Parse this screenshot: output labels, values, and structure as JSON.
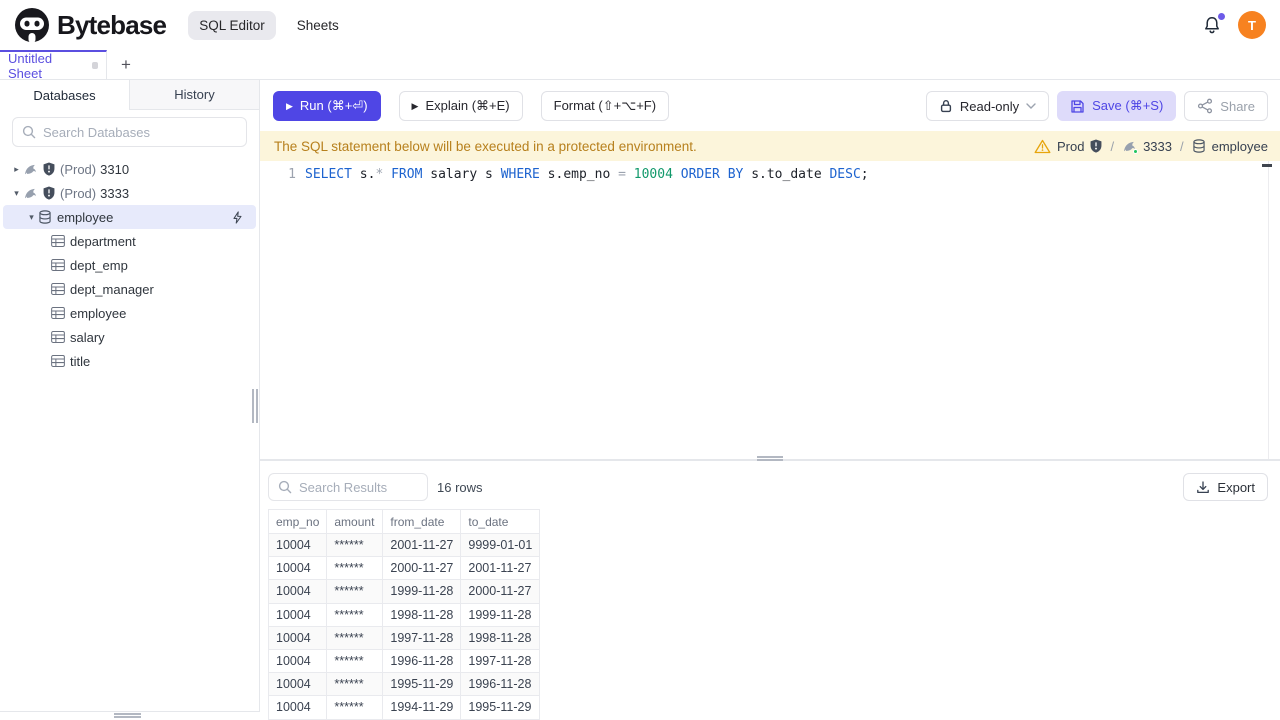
{
  "header": {
    "brand": "Bytebase",
    "nav": [
      {
        "label": "SQL Editor",
        "active": true
      },
      {
        "label": "Sheets",
        "active": false
      }
    ],
    "avatar_letter": "T"
  },
  "sheet_tabbar": {
    "active_tab_label": "Untitled Sheet",
    "new_tab_label": "+"
  },
  "sidebar": {
    "tabs": [
      {
        "label": "Databases",
        "active": true
      },
      {
        "label": "History",
        "active": false
      }
    ],
    "search_placeholder": "Search Databases",
    "tree": [
      {
        "kind": "instance",
        "twisty": "collapsed",
        "env": "(Prod)",
        "name": "3310",
        "icons": [
          "mysql",
          "shield"
        ],
        "indent": 10
      },
      {
        "kind": "instance",
        "twisty": "expanded",
        "env": "(Prod)",
        "name": "3333",
        "icons": [
          "mysql",
          "shield"
        ],
        "indent": 10
      },
      {
        "kind": "database",
        "twisty": "expanded",
        "name": "employee",
        "icons": [
          "database"
        ],
        "indent": 22,
        "selected": true,
        "bolt": true
      },
      {
        "kind": "table",
        "name": "department",
        "icons": [
          "table"
        ],
        "indent": 51
      },
      {
        "kind": "table",
        "name": "dept_emp",
        "icons": [
          "table"
        ],
        "indent": 51
      },
      {
        "kind": "table",
        "name": "dept_manager",
        "icons": [
          "table"
        ],
        "indent": 51
      },
      {
        "kind": "table",
        "name": "employee",
        "icons": [
          "table"
        ],
        "indent": 51
      },
      {
        "kind": "table",
        "name": "salary",
        "icons": [
          "table"
        ],
        "indent": 51
      },
      {
        "kind": "table",
        "name": "title",
        "icons": [
          "table"
        ],
        "indent": 51
      }
    ]
  },
  "toolbar": {
    "run_label": "Run (⌘+⏎)",
    "explain_label": "Explain (⌘+E)",
    "format_label": "Format (⇧+⌥+F)",
    "readonly_label": "Read-only",
    "save_label": "Save (⌘+S)",
    "share_label": "Share"
  },
  "banner": {
    "message": "The SQL statement below will be executed in a protected environment.",
    "environment": "Prod",
    "instance": "3333",
    "database": "employee",
    "separator": "/"
  },
  "editor": {
    "line_number": "1",
    "sql_text": "SELECT s.* FROM salary s WHERE s.emp_no = 10004 ORDER BY s.to_date DESC;",
    "tokens": [
      {
        "text": "SELECT",
        "type": "kw"
      },
      {
        "text": " s.",
        "type": "plain"
      },
      {
        "text": "*",
        "type": "op"
      },
      {
        "text": " ",
        "type": "plain"
      },
      {
        "text": "FROM",
        "type": "kw"
      },
      {
        "text": " salary s ",
        "type": "plain"
      },
      {
        "text": "WHERE",
        "type": "kw"
      },
      {
        "text": " s.emp_no ",
        "type": "plain"
      },
      {
        "text": "=",
        "type": "op"
      },
      {
        "text": " ",
        "type": "plain"
      },
      {
        "text": "10004",
        "type": "num"
      },
      {
        "text": " ",
        "type": "plain"
      },
      {
        "text": "ORDER BY",
        "type": "kw"
      },
      {
        "text": " s.to_date ",
        "type": "plain"
      },
      {
        "text": "DESC",
        "type": "kw"
      },
      {
        "text": ";",
        "type": "plain"
      }
    ]
  },
  "results": {
    "search_placeholder": "Search Results",
    "row_count": "16 rows",
    "export_label": "Export",
    "table": {
      "columns": [
        "emp_no",
        "amount",
        "from_date",
        "to_date"
      ],
      "rows": [
        [
          "10004",
          "******",
          "2001-11-27",
          "9999-01-01"
        ],
        [
          "10004",
          "******",
          "2000-11-27",
          "2001-11-27"
        ],
        [
          "10004",
          "******",
          "1999-11-28",
          "2000-11-27"
        ],
        [
          "10004",
          "******",
          "1998-11-28",
          "1999-11-28"
        ],
        [
          "10004",
          "******",
          "1997-11-28",
          "1998-11-28"
        ],
        [
          "10004",
          "******",
          "1996-11-28",
          "1997-11-28"
        ],
        [
          "10004",
          "******",
          "1995-11-29",
          "1996-11-28"
        ],
        [
          "10004",
          "******",
          "1994-11-29",
          "1995-11-29"
        ]
      ]
    }
  },
  "colors": {
    "accent": "#4f46e5",
    "accent_soft": "#dedbfa",
    "avatar_orange": "#f78220",
    "banner_bg": "#fcf5db",
    "banner_text": "#b7801d",
    "keyword_blue": "#1d63cf",
    "number_green": "#12996b",
    "selected_tree_bg": "#e7eafb",
    "status_green": "#22c55e",
    "warning_amber": "#e7a50c"
  }
}
